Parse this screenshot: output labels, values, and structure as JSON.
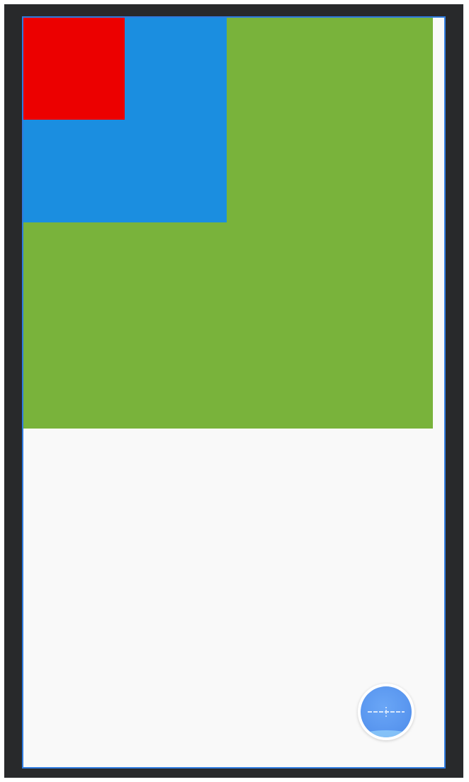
{
  "colors": {
    "frame": "#28292b",
    "screen_background": "#f9f9f9",
    "screen_border": "#2f7be0",
    "green_box": "#79b33b",
    "blue_box": "#1b8ee0",
    "red_box": "#ec0000",
    "fab": "#5b98f0"
  },
  "fab": {
    "icon": "dashed-divider-icon"
  }
}
